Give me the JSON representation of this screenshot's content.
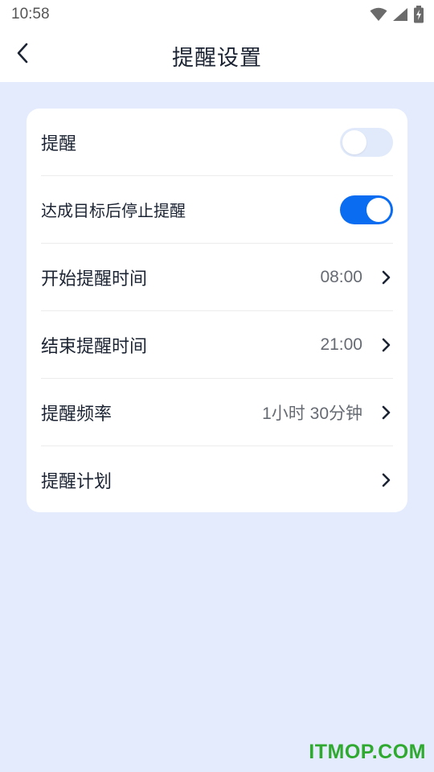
{
  "status_bar": {
    "time": "10:58",
    "icons": [
      "wifi-icon",
      "cellular-signal-icon",
      "battery-charging-icon"
    ]
  },
  "header": {
    "back_icon": "chevron-left-icon",
    "title": "提醒设置"
  },
  "settings": {
    "reminder": {
      "label": "提醒",
      "enabled": false
    },
    "stop_after_goal": {
      "label": "达成目标后停止提醒",
      "enabled": true
    },
    "start_time": {
      "label": "开始提醒时间",
      "value": "08:00"
    },
    "end_time": {
      "label": "结束提醒时间",
      "value": "21:00"
    },
    "frequency": {
      "label": "提醒频率",
      "value": "1小时 30分钟"
    },
    "plan": {
      "label": "提醒计划"
    }
  },
  "colors": {
    "background": "#e3ebfd",
    "toggle_on": "#0a6cf0",
    "toggle_off": "#e1eafb",
    "watermark": "#2fa92f"
  },
  "watermark": "ITMOP.COM"
}
